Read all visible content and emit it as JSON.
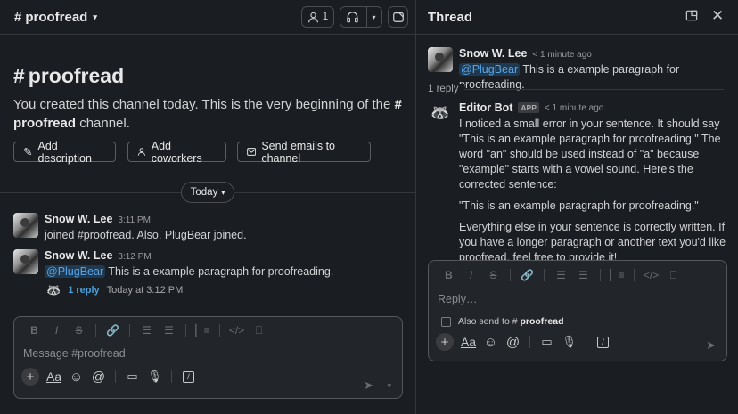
{
  "channel": {
    "name": "proofread",
    "hash": "#",
    "member_count": "1"
  },
  "intro": {
    "text_prefix": "You created this channel today. This is the very beginning of the",
    "channel_bold": "proofread",
    "text_suffix": "channel.",
    "buttons": [
      "Add description",
      "Add coworkers",
      "Send emails to channel"
    ]
  },
  "divider": {
    "label": "Today"
  },
  "messages": [
    {
      "author": "Snow W. Lee",
      "time": "3:11 PM",
      "text": "joined #proofread. Also, PlugBear joined."
    },
    {
      "author": "Snow W. Lee",
      "time": "3:12 PM",
      "mention": "@PlugBear",
      "text": "This is a example paragraph for proofreading."
    }
  ],
  "reply_summary": {
    "link": "1 reply",
    "time": "Today at 3:12 PM"
  },
  "composer": {
    "placeholder": "Message #proofread"
  },
  "thread": {
    "title": "Thread",
    "root": {
      "author": "Snow W. Lee",
      "time": "< 1 minute ago",
      "mention": "@PlugBear",
      "text": "This is a example paragraph for proofreading."
    },
    "reply_count": "1 reply",
    "bot": {
      "author": "Editor Bot",
      "tag": "APP",
      "time": "< 1 minute ago",
      "paragraphs": [
        "I noticed a small error in your sentence. It should say \"This is an example paragraph for proofreading.\" The word \"an\" should be used instead of \"a\" because \"example\" starts with a vowel sound. Here's the corrected sentence:",
        "\"This is an example paragraph for proofreading.\"",
        "Everything else in your sentence is correctly written. If you have a longer paragraph or another text you'd like proofread, feel free to provide it!"
      ]
    },
    "composer": {
      "placeholder": "Reply…",
      "also_send_prefix": "Also send to",
      "also_send_channel": "proofread"
    }
  },
  "colors": {
    "background": "#1a1d21",
    "mention_bg": "#1d3a52",
    "link": "#4a9fd9"
  }
}
